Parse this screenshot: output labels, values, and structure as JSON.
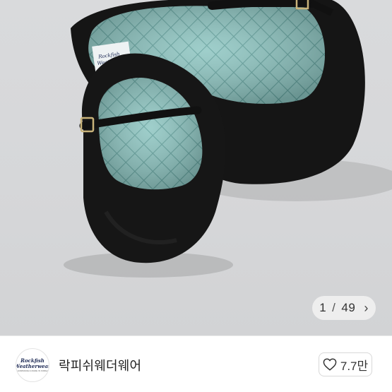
{
  "gallery": {
    "current": "1",
    "separator": "/",
    "total": "49",
    "next_icon": "chevron-right-icon",
    "insole_label_line1": "Rockfish",
    "insole_label_line2": "Weatherwear"
  },
  "seller": {
    "name": "락피쉬웨더웨어",
    "avatar_logo_line1": "Rockfish",
    "avatar_logo_line2": "Weatherwear",
    "avatar_logo_sub": "HANDMADE & MADE IN KOREA"
  },
  "like": {
    "icon": "heart-icon",
    "count": "7.7만"
  },
  "colors": {
    "shoe": "#141414",
    "lining": "#8fc7c3",
    "background": "#d8d9db"
  }
}
